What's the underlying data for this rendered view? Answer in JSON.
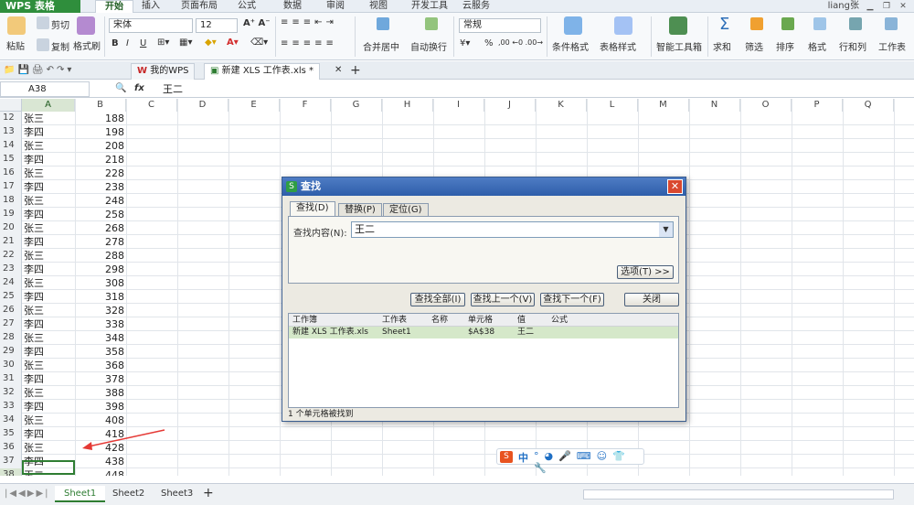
{
  "app": {
    "name": "WPS 表格",
    "account": "liang张"
  },
  "menu": {
    "tabs": [
      "开始",
      "插入",
      "页面布局",
      "公式",
      "数据",
      "审阅",
      "视图",
      "开发工具",
      "云服务"
    ]
  },
  "ribbon": {
    "paste": "粘贴",
    "cut": "剪切",
    "copy": "复制",
    "format_painter": "格式刷",
    "font_name": "宋体",
    "font_size": "12",
    "merge_center": "合并居中",
    "wrap_text": "自动换行",
    "number_format": "常规",
    "percent": "%",
    "conditional_format": "条件格式",
    "table_style": "表格样式",
    "smart_toolbox": "智能工具箱",
    "sum": "求和",
    "filter": "筛选",
    "sort": "排序",
    "format": "格式",
    "row_col": "行和列",
    "worksheet": "工作表"
  },
  "doc_tabs": {
    "home": "我的WPS",
    "file": "新建 XLS 工作表.xls *"
  },
  "formula_bar": {
    "cell_ref": "A38",
    "fx": "fx",
    "value": "王二"
  },
  "columns": [
    "A",
    "B",
    "C",
    "D",
    "E",
    "F",
    "G",
    "H",
    "I",
    "J",
    "K",
    "L",
    "M",
    "N",
    "O",
    "P",
    "Q"
  ],
  "rows": [
    {
      "n": "12",
      "a": "张三",
      "b": "188"
    },
    {
      "n": "13",
      "a": "李四",
      "b": "198"
    },
    {
      "n": "14",
      "a": "张三",
      "b": "208"
    },
    {
      "n": "15",
      "a": "李四",
      "b": "218"
    },
    {
      "n": "16",
      "a": "张三",
      "b": "228"
    },
    {
      "n": "17",
      "a": "李四",
      "b": "238"
    },
    {
      "n": "18",
      "a": "张三",
      "b": "248"
    },
    {
      "n": "19",
      "a": "李四",
      "b": "258"
    },
    {
      "n": "20",
      "a": "张三",
      "b": "268"
    },
    {
      "n": "21",
      "a": "李四",
      "b": "278"
    },
    {
      "n": "22",
      "a": "张三",
      "b": "288"
    },
    {
      "n": "23",
      "a": "李四",
      "b": "298"
    },
    {
      "n": "24",
      "a": "张三",
      "b": "308"
    },
    {
      "n": "25",
      "a": "李四",
      "b": "318"
    },
    {
      "n": "26",
      "a": "张三",
      "b": "328"
    },
    {
      "n": "27",
      "a": "李四",
      "b": "338"
    },
    {
      "n": "28",
      "a": "张三",
      "b": "348"
    },
    {
      "n": "29",
      "a": "李四",
      "b": "358"
    },
    {
      "n": "30",
      "a": "张三",
      "b": "368"
    },
    {
      "n": "31",
      "a": "李四",
      "b": "378"
    },
    {
      "n": "32",
      "a": "张三",
      "b": "388"
    },
    {
      "n": "33",
      "a": "李四",
      "b": "398"
    },
    {
      "n": "34",
      "a": "张三",
      "b": "408"
    },
    {
      "n": "35",
      "a": "李四",
      "b": "418"
    },
    {
      "n": "36",
      "a": "张三",
      "b": "428"
    },
    {
      "n": "37",
      "a": "李四",
      "b": "438"
    },
    {
      "n": "38",
      "a": "王二",
      "b": "448"
    },
    {
      "n": "39",
      "a": "",
      "b": ""
    }
  ],
  "sheets": [
    "Sheet1",
    "Sheet2",
    "Sheet3"
  ],
  "dialog": {
    "title": "查找",
    "tabs": [
      "查找(D)",
      "替换(P)",
      "定位(G)"
    ],
    "find_label": "查找内容(N):",
    "find_value": "王二",
    "options_btn": "选项(T) >>",
    "find_all": "查找全部(I)",
    "find_prev": "查找上一个(V)",
    "find_next": "查找下一个(F)",
    "close": "关闭",
    "result_headers": [
      "工作簿",
      "工作表",
      "名称",
      "单元格",
      "值",
      "公式"
    ],
    "result_row": [
      "新建 XLS 工作表.xls",
      "Sheet1",
      "",
      "$A$38",
      "王二",
      ""
    ],
    "status": "1 个单元格被找到"
  },
  "ime": {
    "label": "中"
  },
  "colors": {
    "brand": "#2f8e3c",
    "selection": "#2e7d32",
    "dialog_title": "#2e5eaa",
    "annotation": "#e53935"
  }
}
